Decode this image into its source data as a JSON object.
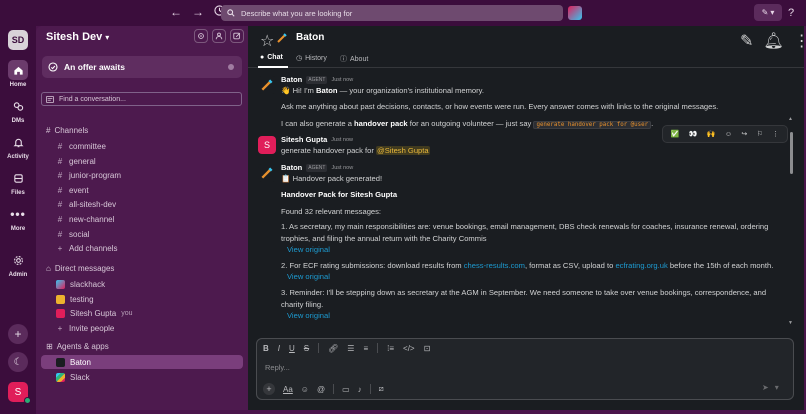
{
  "topbar": {
    "search_placeholder": "Describe what you are looking for",
    "help": "?"
  },
  "workspace": {
    "initials": "SD",
    "name": "Sitesh Dev",
    "user_initial": "S"
  },
  "rail": [
    {
      "label": "Home"
    },
    {
      "label": "DMs"
    },
    {
      "label": "Activity"
    },
    {
      "label": "Files"
    },
    {
      "label": "More"
    },
    {
      "label": "Admin"
    }
  ],
  "sidebar": {
    "offer": "An offer awaits",
    "find_placeholder": "Find a conversation...",
    "channels_title": "Channels",
    "channels": [
      "committee",
      "general",
      "junior-program",
      "event",
      "all-sitesh-dev",
      "new-channel",
      "social"
    ],
    "add_channels": "Add channels",
    "dms_title": "Direct messages",
    "dms": [
      {
        "name": "slackhack",
        "suffix": ""
      },
      {
        "name": "testing",
        "suffix": ""
      },
      {
        "name": "Sitesh Gupta",
        "suffix": "you"
      }
    ],
    "invite": "Invite people",
    "apps_title": "Agents & apps",
    "apps": [
      "Baton",
      "Slack"
    ]
  },
  "channel": {
    "title": "Baton",
    "tabs": [
      "Chat",
      "History",
      "About"
    ]
  },
  "messages": {
    "m1": {
      "author": "Baton",
      "badge": "AGENT",
      "time": "Just now",
      "l1_emoji": "👋",
      "l1_a": "Hi! I'm ",
      "l1_b": "Baton",
      "l1_c": " — your organization's institutional memory.",
      "l2": "Ask me anything about past decisions, contacts, or how events were run. Every answer comes with links to the original messages.",
      "l3_a": "I can also generate a ",
      "l3_b": "handover pack",
      "l3_c": " for an outgoing volunteer — just say ",
      "l3_code": "generate handover pack for @user",
      "l3_d": "."
    },
    "m2": {
      "author": "Sitesh Gupta",
      "time": "Just now",
      "text": "generate handover pack for ",
      "mention": "@Sitesh Gupta"
    },
    "m3": {
      "author": "Baton",
      "badge": "AGENT",
      "time": "Just now",
      "generated": "Handover pack generated!",
      "heading": "Handover Pack for Sitesh Gupta",
      "found": "Found 32 relevant messages:",
      "i1a": "1. As secretary, my main responsibilities are: venue bookings, email management, DBS check renewals for coaches, insurance renewal, ordering",
      "i1b": "trophies, and filing the annual return with the Charity Commis",
      "i2_a": "2. For ECF rating submissions: download results from ",
      "i2_link1": "chess-results.com",
      "i2_b": ", format as CSV, upload to ",
      "i2_link2": "ecfrating.org.uk",
      "i2_c": " before the 15th of each month.",
      "i3a": "3. Reminder: I'll be stepping down as secretary at the AGM in September. We need someone to take over venue bookings, correspondence, and",
      "i3b": "charity filing.",
      "view_original": "View original"
    }
  },
  "composer": {
    "placeholder": "Reply..."
  },
  "colors": {
    "aubergine": "#4a154b",
    "main_bg": "#1a1d21",
    "link": "#1d9bd1",
    "mention": "#e8b83b",
    "selected": "#7a3e7c"
  }
}
